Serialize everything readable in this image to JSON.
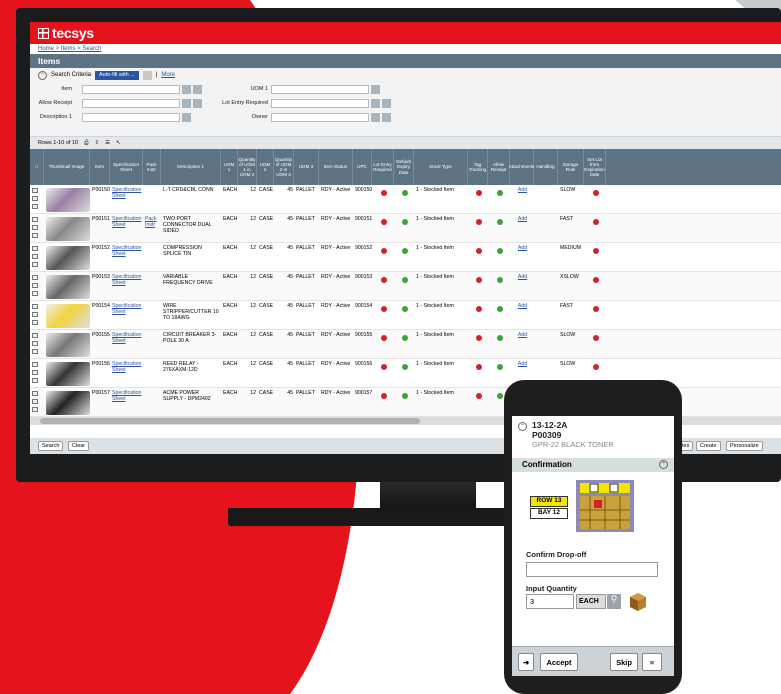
{
  "brand": {
    "logo_text": "tecsys",
    "red": "#e5141c",
    "slate": "#5e7384"
  },
  "app": {
    "breadcrumb": "Home > Items > Search",
    "page_title": "Items",
    "search_criteria": {
      "label": "Search Criteria",
      "selected": "Auto-fill with ...",
      "more": "More"
    },
    "fields": {
      "item": "Item",
      "allow_receipt": "Allow Receipt",
      "description1": "Description 1",
      "uom1": "UOM 1",
      "lot_entry_required": "Lot Entry Required",
      "owner": "Owner"
    },
    "rows_info": "Rows 1-10 of 10",
    "columns": [
      "Thumbnail Image",
      "Item",
      "Specification Sheet",
      "Pack Instr",
      "Description 1",
      "UOM 1",
      "Quantity of UOM 1 in UOM 2",
      "UOM 2",
      "Quantity of UOM 2 in UOM 3",
      "UOM 3",
      "Item Status",
      "UPC",
      "Lot Entry Required",
      "Default Expiry Date",
      "Stock Type",
      "Tag Tracking",
      "Allow Receipt",
      "Attachments",
      "Handling",
      "Storage Rule",
      "Set Lot from Expiration Date"
    ],
    "rows": [
      {
        "item": "P00150",
        "spec": "Specification Sheet",
        "pack": "",
        "desc": "L-T CRD&CBL CONN",
        "uom1": "EACH",
        "q1": "12",
        "uom2": "CASE",
        "q2": "45",
        "uom3": "PALLET",
        "status": "RDY - Active",
        "upc": "900150",
        "stock": "1 - Stocked Item",
        "attach": "Add",
        "rule": "SLOW"
      },
      {
        "item": "P00151",
        "spec": "Specification Sheet",
        "pack": "Pack Instr",
        "desc": "TWO PORT CONNECTOR DUAL SIDED",
        "uom1": "EACH",
        "q1": "12",
        "uom2": "CASE",
        "q2": "45",
        "uom3": "PALLET",
        "status": "RDY - Active",
        "upc": "900151",
        "stock": "1 - Stocked Item",
        "attach": "Add",
        "rule": "FAST"
      },
      {
        "item": "P00152",
        "spec": "Specification Sheet",
        "pack": "",
        "desc": "COMPRESSION SPLICE TIN",
        "uom1": "EACH",
        "q1": "12",
        "uom2": "CASE",
        "q2": "45",
        "uom3": "PALLET",
        "status": "RDY - Active",
        "upc": "900152",
        "stock": "1 - Stocked Item",
        "attach": "Add",
        "rule": "MEDIUM"
      },
      {
        "item": "P00153",
        "spec": "Specification Sheet",
        "pack": "",
        "desc": "VARIABLE FREQUENCY DRIVE",
        "uom1": "EACH",
        "q1": "12",
        "uom2": "CASE",
        "q2": "45",
        "uom3": "PALLET",
        "status": "RDY - Active",
        "upc": "900153",
        "stock": "1 - Stocked Item",
        "attach": "Add",
        "rule": "XSLOW"
      },
      {
        "item": "P00154",
        "spec": "Specification Sheet",
        "pack": "",
        "desc": "WIRE STRIPPER/CUTTER 10 TO 18AWG",
        "uom1": "EACH",
        "q1": "12",
        "uom2": "CASE",
        "q2": "45",
        "uom3": "PALLET",
        "status": "RDY - Active",
        "upc": "900154",
        "stock": "1 - Stocked Item",
        "attach": "Add",
        "rule": "FAST"
      },
      {
        "item": "P00155",
        "spec": "Specification Sheet",
        "pack": "",
        "desc": "CIRCUIT BREAKER 3-POLE 30 A",
        "uom1": "EACH",
        "q1": "12",
        "uom2": "CASE",
        "q2": "45",
        "uom3": "PALLET",
        "status": "RDY - Active",
        "upc": "900155",
        "stock": "1 - Stocked Item",
        "attach": "Add",
        "rule": "SLOW"
      },
      {
        "item": "P00156",
        "spec": "Specification Sheet",
        "pack": "",
        "desc": "REED RELAY - 276XAXM-12D",
        "uom1": "EACH",
        "q1": "12",
        "uom2": "CASE",
        "q2": "45",
        "uom3": "PALLET",
        "status": "RDY - Active",
        "upc": "900156",
        "stock": "1 - Stocked Item",
        "attach": "Add",
        "rule": "SLOW"
      },
      {
        "item": "P00157",
        "spec": "Specification Sheet",
        "pack": "",
        "desc": "ACME POWER SUPPLY - DPM2402",
        "uom1": "EACH",
        "q1": "12",
        "uom2": "CASE",
        "q2": "45",
        "uom3": "PALLET",
        "status": "RDY - Active",
        "upc": "900157",
        "stock": "1 - Stocked Item",
        "attach": "Add",
        "rule": "MEDIUM"
      }
    ],
    "bottom": {
      "search": "Search",
      "clear": "Clear",
      "tes": "tes",
      "create": "Create",
      "personalize": "Personalize"
    }
  },
  "phone": {
    "location": "13-12-2A",
    "item": "P00309",
    "desc": "GPR-22 BLACK TONER",
    "confirmation": "Confirmation",
    "row_tag": "ROW 13",
    "bay_tag": "BAY 12",
    "confirm_dropoff": "Confirm Drop-off",
    "input_quantity": "Input Quantity",
    "qty_value": "3",
    "uom": "EACH",
    "accept": "Accept",
    "skip": "Skip"
  }
}
